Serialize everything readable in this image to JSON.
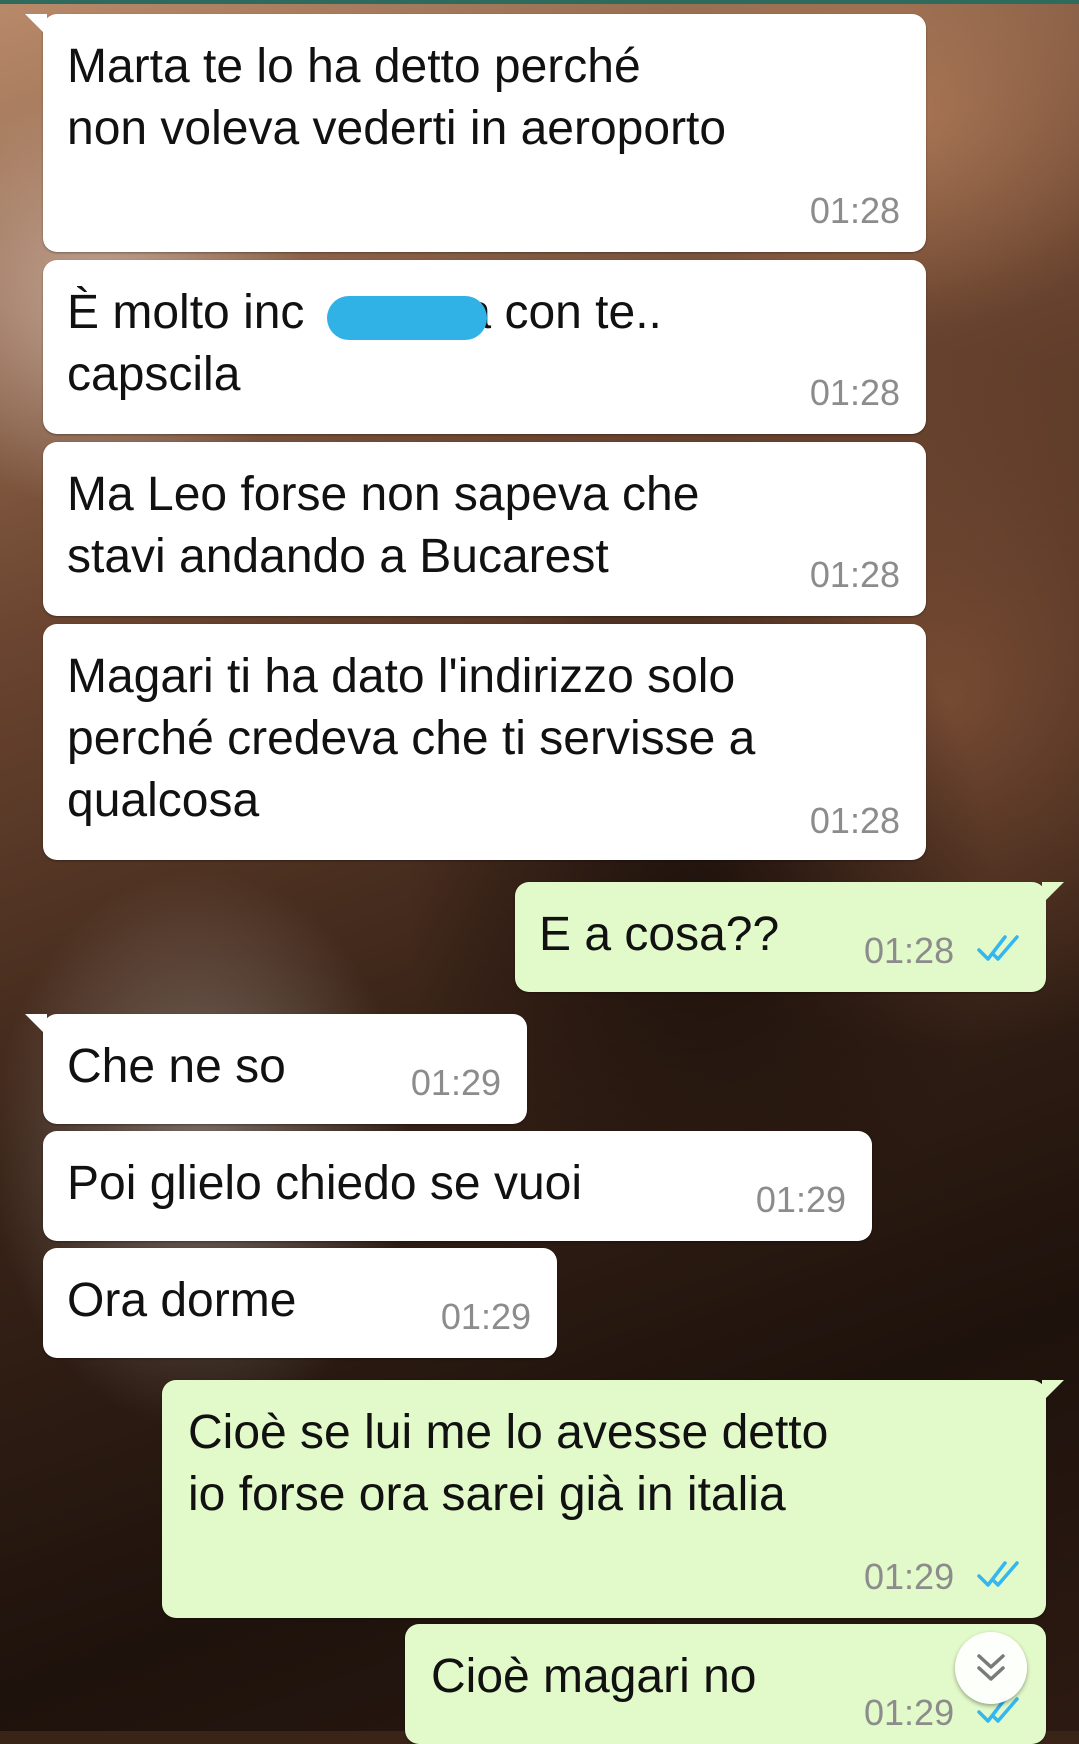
{
  "messages": [
    {
      "direction": "in",
      "text": "Marta te lo ha detto perché\nnon voleva vederti in aeroporto",
      "time": "01:28"
    },
    {
      "direction": "in",
      "text_before": "È molto inc",
      "text_after": "a con te..",
      "line2": "capscila",
      "time": "01:28"
    },
    {
      "direction": "in",
      "text": "Ma Leo forse non sapeva che\nstavi andando a Bucarest",
      "time": "01:28"
    },
    {
      "direction": "in",
      "text": "Magari ti ha dato l'indirizzo solo\nperché credeva che ti servisse a\nqualcosa",
      "time": "01:28"
    },
    {
      "direction": "out",
      "text": "E a cosa??",
      "time": "01:28",
      "status": "read"
    },
    {
      "direction": "in",
      "text": "Che ne so",
      "time": "01:29"
    },
    {
      "direction": "in",
      "text": "Poi glielo chiedo se vuoi",
      "time": "01:29"
    },
    {
      "direction": "in",
      "text": "Ora dorme",
      "time": "01:29"
    },
    {
      "direction": "out",
      "text": "Cioè se lui me lo avesse detto\nio forse ora sarei già in italia",
      "time": "01:29",
      "status": "read"
    },
    {
      "direction": "out",
      "text": "Cioè magari no",
      "time": "01:29",
      "status": "read"
    }
  ],
  "icons": {
    "read_ticks": "double-check-icon",
    "scroll_down": "double-chevron-down-icon"
  },
  "colors": {
    "incoming_bubble": "#ffffff",
    "outgoing_bubble": "#e2f9c9",
    "read_tick": "#34b7f1",
    "redaction": "#30b2e6"
  }
}
